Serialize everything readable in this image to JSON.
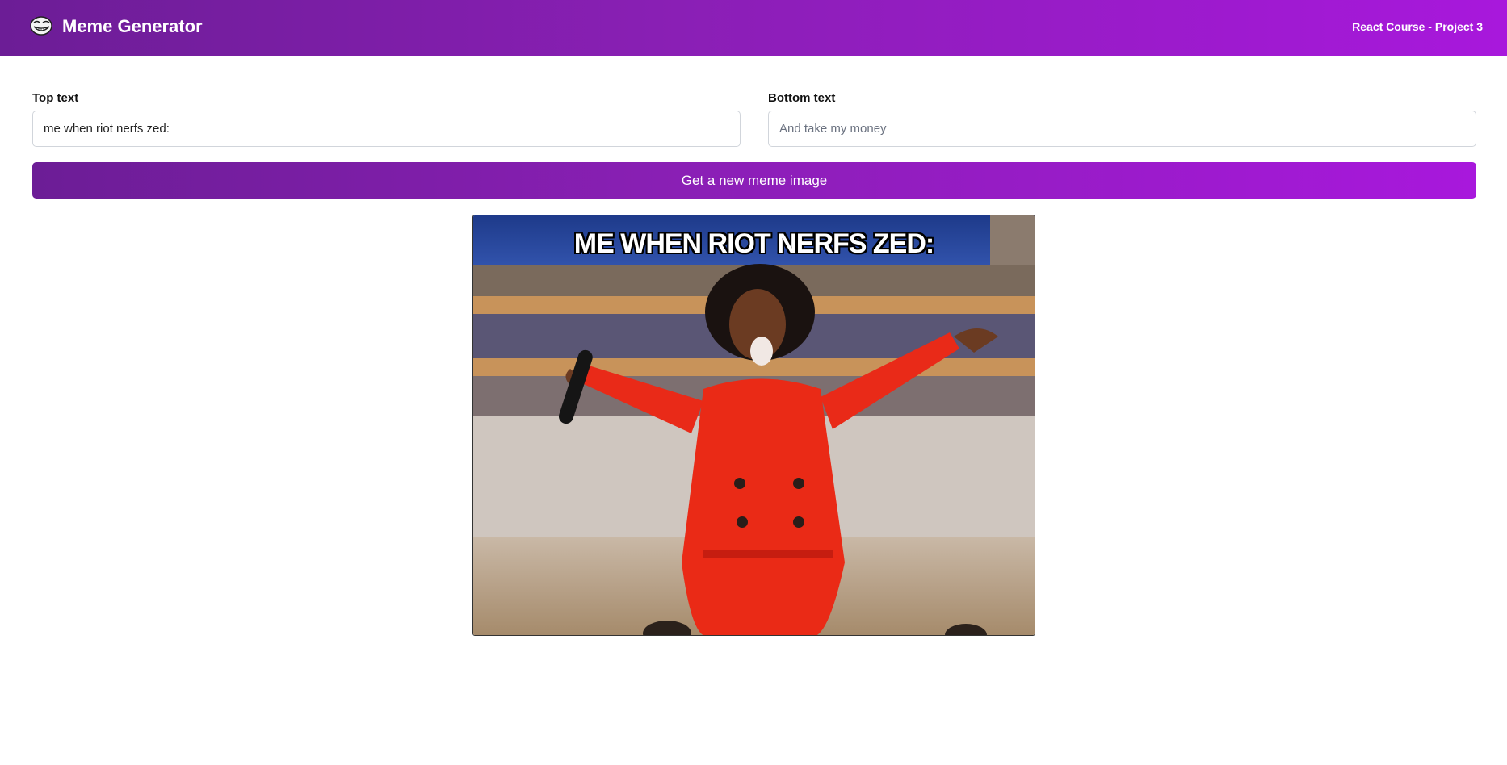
{
  "header": {
    "logo_icon": "troll-face-icon",
    "title": "Meme Generator",
    "course": "React Course - Project 3",
    "gradient_start": "#6c1d96",
    "gradient_end": "#a818dc"
  },
  "form": {
    "top_text": {
      "label": "Top text",
      "value": "me when riot nerfs zed:",
      "placeholder": ""
    },
    "bottom_text": {
      "label": "Bottom text",
      "value": "",
      "placeholder": "And take my money"
    },
    "button_label": "Get a new meme image"
  },
  "meme": {
    "image_icon": "oprah-you-get-a-car-image",
    "top_text": "me when riot nerfs zed:",
    "bottom_text": ""
  }
}
